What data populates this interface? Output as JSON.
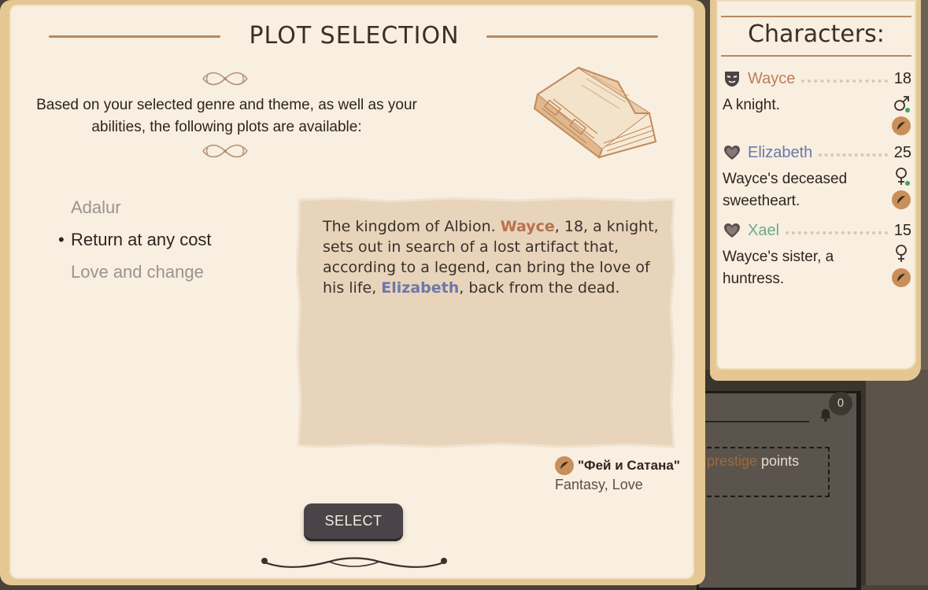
{
  "background": {
    "notification_count": "0",
    "prestige_accent": "prestige",
    "prestige_rest": " points"
  },
  "plot_selection": {
    "title": "PLOT SELECTION",
    "intro": "Based on your selected genre and theme, as well as your abilities, the following plots are available:",
    "plots": [
      {
        "label": "Adalur",
        "selected": false
      },
      {
        "label": "Return at any cost",
        "selected": true
      },
      {
        "label": "Love and change",
        "selected": false
      }
    ],
    "bullet": "•",
    "description": {
      "part1": "The kingdom of Albion. ",
      "name1": "Wayce",
      "part2": ", 18, a knight, sets out in search of a lost artifact that, according to a legend, can bring the love of his life, ",
      "name2": "Elizabeth",
      "part3": ", back from the dead."
    },
    "author": "\"Фей и Сатана\"",
    "genres": "Fantasy, Love",
    "select_label": "SELECT"
  },
  "characters": {
    "title": "Characters:",
    "list": [
      {
        "name": "Wayce",
        "age": "18",
        "desc": "A knight.",
        "name_color": "#c07c5c",
        "icon": "mask-icon",
        "gender": "male-icon",
        "online": true
      },
      {
        "name": "Elizabeth",
        "age": "25",
        "desc": "Wayce's deceased sweetheart.",
        "name_color": "#6c77aa",
        "icon": "heart-icon",
        "gender": "female-icon",
        "online": true
      },
      {
        "name": "Xael",
        "age": "15",
        "desc": "Wayce's sister, a huntress.",
        "name_color": "#6aab90",
        "icon": "heart-icon",
        "gender": "female-icon",
        "online": false
      }
    ]
  },
  "colors": {
    "parchment": "#f8efe0",
    "border": "#e4c792",
    "button": "#4a4448",
    "accent_brown": "#c88f5b"
  }
}
